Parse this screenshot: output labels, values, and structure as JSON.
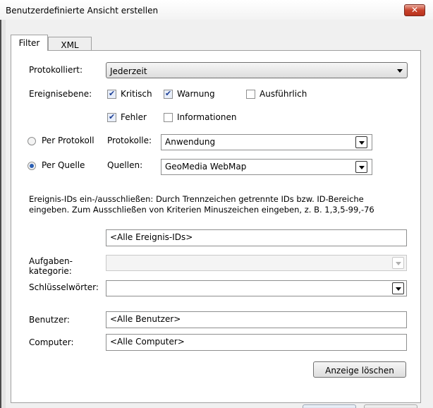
{
  "window": {
    "title": "Benutzerdefinierte Ansicht erstellen",
    "close_glyph": "✕"
  },
  "tabs": [
    {
      "label": "Filter",
      "active": true
    },
    {
      "label": "XML",
      "active": false
    }
  ],
  "filter": {
    "logged_label": "Protokolliert:",
    "logged_value": "Jederzeit",
    "level_label": "Ereignisebene:",
    "levels": [
      {
        "label": "Kritisch",
        "checked": true
      },
      {
        "label": "Warnung",
        "checked": true
      },
      {
        "label": "Ausführlich",
        "checked": false
      },
      {
        "label": "Fehler",
        "checked": true
      },
      {
        "label": "Informationen",
        "checked": false
      }
    ],
    "by_log_label": "Per Protokoll",
    "by_source_label": "Per Quelle",
    "selected_mode": "by_source",
    "logs_label": "Protokolle:",
    "logs_value": "Anwendung",
    "sources_label": "Quellen:",
    "sources_value": "GeoMedia WebMap",
    "event_ids_help_line1": "Ereignis-IDs ein-/ausschließen: Durch Trennzeichen getrennte IDs bzw. ID-Bereiche",
    "event_ids_help_line2": "eingeben. Zum Ausschließen von Kriterien Minuszeichen eingeben, z. B. 1,3,5-99,-76",
    "event_ids_value": "<Alle Ereignis-IDs>",
    "task_category_label_line1": "Aufgaben-",
    "task_category_label_line2": "kategorie:",
    "task_category_value": "",
    "keywords_label": "Schlüsselwörter:",
    "keywords_value": "",
    "user_label": "Benutzer:",
    "user_value": "<Alle Benutzer>",
    "computer_label": "Computer:",
    "computer_value": "<Alle Computer>",
    "clear_button_label": "Anzeige löschen"
  },
  "colors": {
    "radio_accent": "#2b5fb3",
    "close_button": "#c8432c",
    "checkmark": "#1c3f96"
  }
}
